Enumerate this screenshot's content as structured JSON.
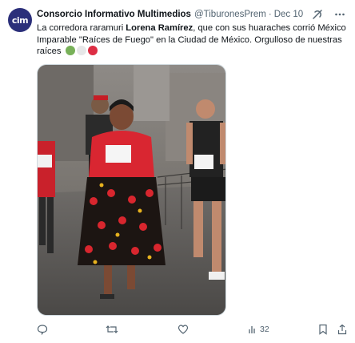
{
  "author": {
    "avatar_text": "cim",
    "name": "Consorcio Informativo Multimedios",
    "handle": "@TiburonesPrem",
    "separator": "·",
    "date": "Dec 10"
  },
  "tweet": {
    "text_before": "La corredora raramuri ",
    "text_bold": "Lorena Ramírez",
    "text_after": ", que con sus huaraches corrió México Imparable \"Raíces de Fuego\" en la Ciudad de México. Orgulloso de nuestras raíces",
    "emoji_colors": [
      "#78b159",
      "#e6e7e8",
      "#dd2e44"
    ]
  },
  "actions": {
    "views_count": "32"
  },
  "colors": {
    "avatar_bg": "#2b2f7a",
    "secondary_text": "#536471"
  },
  "icons": [
    "grok-icon",
    "more-icon",
    "reply-icon",
    "retweet-icon",
    "like-icon",
    "views-icon",
    "bookmark-icon",
    "share-icon"
  ]
}
